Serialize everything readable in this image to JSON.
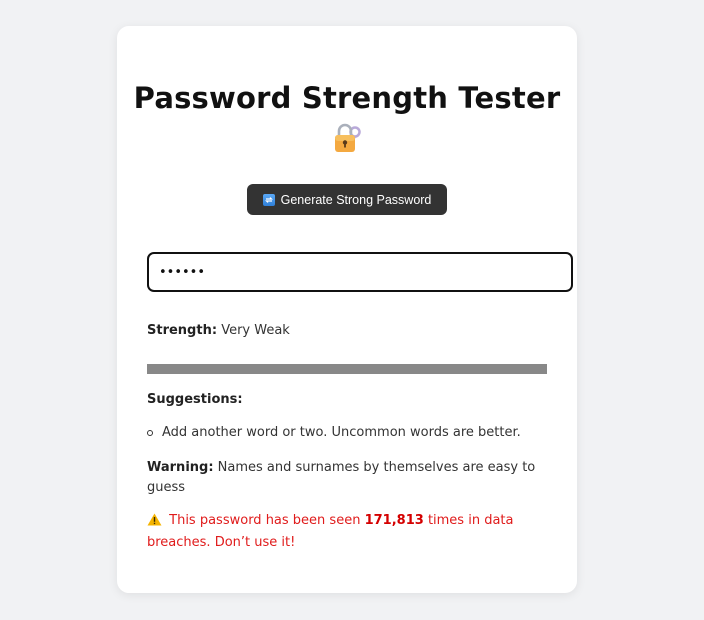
{
  "title": "Password Strength Tester",
  "title_icon": "lock-with-key-icon",
  "generate_button": {
    "icon": "refresh-icon",
    "label": "Generate Strong Password"
  },
  "password_input": {
    "value": "••••••",
    "masked": true
  },
  "strength": {
    "label": "Strength:",
    "value": "Very Weak",
    "meter_fill_percent": 100,
    "meter_color": "#888888"
  },
  "suggestions": {
    "heading": "Suggestions:",
    "items": [
      "Add another word or two. Uncommon words are better."
    ]
  },
  "warning": {
    "label": "Warning:",
    "text": "Names and surnames by themselves are easy to guess"
  },
  "breach": {
    "icon": "warning-icon",
    "prefix": "This password has been seen",
    "count": "171,813",
    "suffix": "times in data breaches. Don’t use it!",
    "color": "#e01b1b"
  }
}
